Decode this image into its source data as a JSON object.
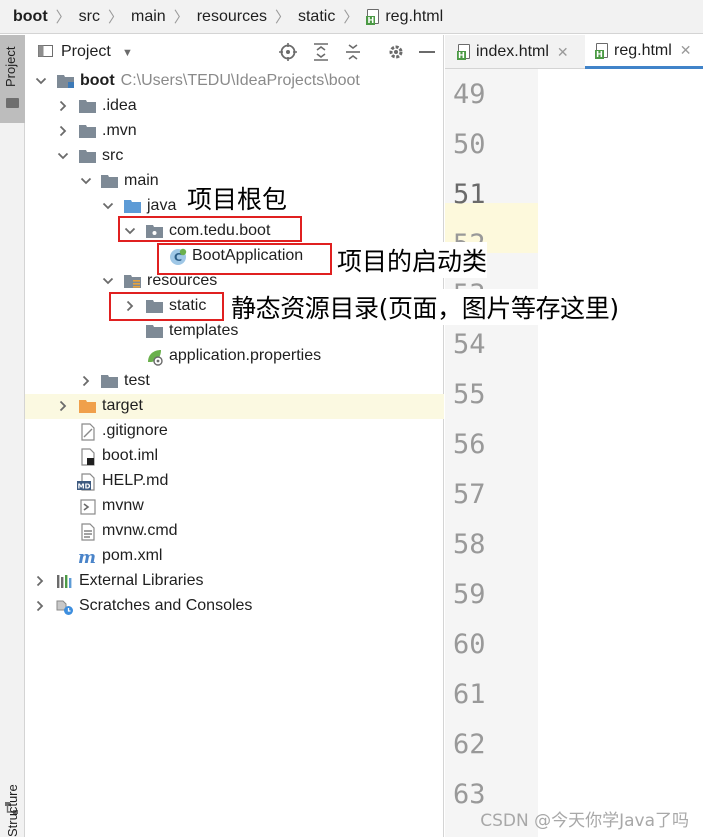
{
  "breadcrumb": [
    "boot",
    "src",
    "main",
    "resources",
    "static",
    "reg.html"
  ],
  "left_strip": {
    "project_tab": "Project",
    "structure_tab": "Structure"
  },
  "project_panel": {
    "title": "Project"
  },
  "tree": [
    {
      "label": "boot",
      "path": "C:\\Users\\TEDU\\IdeaProjects\\boot"
    },
    {
      "label": ".idea"
    },
    {
      "label": ".mvn"
    },
    {
      "label": "src"
    },
    {
      "label": "main"
    },
    {
      "label": "java"
    },
    {
      "label": "com.tedu.boot"
    },
    {
      "label": "BootApplication"
    },
    {
      "label": "resources"
    },
    {
      "label": "static"
    },
    {
      "label": "templates"
    },
    {
      "label": "application.properties"
    },
    {
      "label": "test"
    },
    {
      "label": "target"
    },
    {
      "label": ".gitignore"
    },
    {
      "label": "boot.iml"
    },
    {
      "label": "HELP.md"
    },
    {
      "label": "mvnw"
    },
    {
      "label": "mvnw.cmd"
    },
    {
      "label": "pom.xml"
    },
    {
      "label": "External Libraries"
    },
    {
      "label": "Scratches and Consoles"
    }
  ],
  "editor": {
    "tabs": [
      {
        "label": "index.html"
      },
      {
        "label": "reg.html"
      }
    ],
    "line_numbers": [
      "49",
      "50",
      "51",
      "52",
      "53",
      "54",
      "55",
      "56",
      "57",
      "58",
      "59",
      "60",
      "61",
      "62",
      "63"
    ]
  },
  "annotations": {
    "root_package": "项目根包",
    "startup_class": "项目的启动类",
    "static_dir": "静态资源目录(页面，图片等存这里)"
  },
  "watermark": "CSDN @今天你学Java了吗",
  "colors": {
    "selected_tab_underline": "#4083c9",
    "annotation_box": "#e02020",
    "target_highlight": "#fbf9e1",
    "folder_gray": "#7e8a96",
    "target_folder": "#f0a04b"
  }
}
